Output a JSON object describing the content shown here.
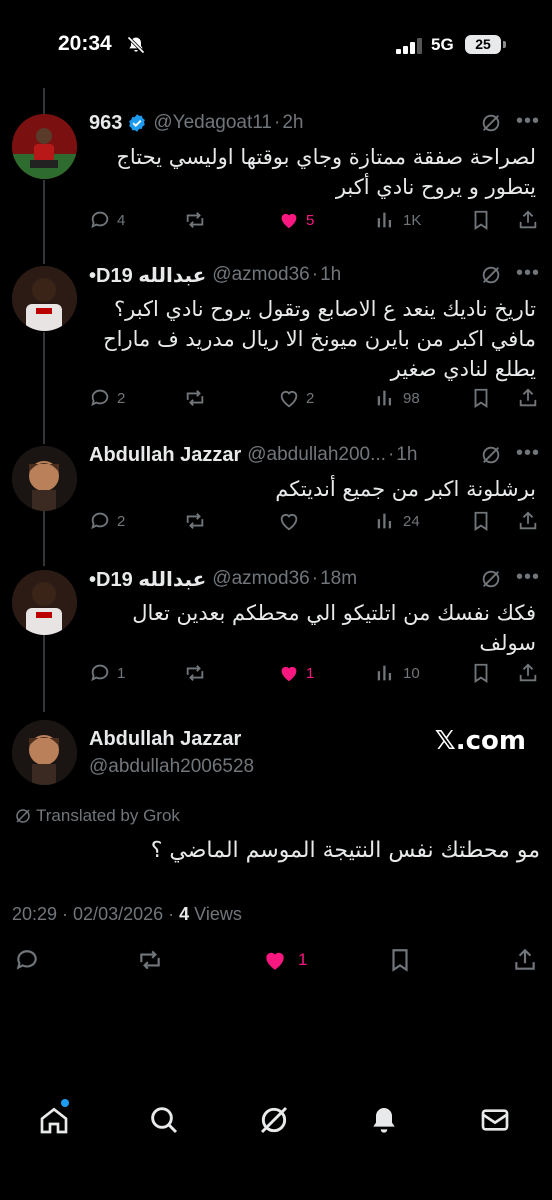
{
  "status_bar": {
    "time": "20:34",
    "network": "5G",
    "battery": "25"
  },
  "tweets": [
    {
      "name": "963",
      "verified": true,
      "handle": "@Yedagoat11",
      "time": "2h",
      "text": "لصراحة صفقة ممتازة وجاي بوقتها اوليسي يحتاج يتطور و يروح نادي أكبر",
      "replies": "4",
      "reposts": "",
      "likes": "5",
      "liked": true,
      "views": "1K"
    },
    {
      "name": "•D19 عبدالله",
      "verified": false,
      "handle": "@azmod36",
      "time": "1h",
      "text": "تاريخ ناديك ينعد ع الاصابع وتقول يروح نادي اكبر؟ مافي اكبر من بايرن ميونخ الا ريال مدريد ف ماراح يطلع لنادي صغير",
      "replies": "2",
      "reposts": "",
      "likes": "2",
      "liked": false,
      "views": "98"
    },
    {
      "name": "Abdullah Jazzar",
      "verified": false,
      "handle": "@abdullah200...",
      "time": "1h",
      "text": "برشلونة اكبر من جميع أنديتكم",
      "replies": "2",
      "reposts": "",
      "likes": "",
      "liked": false,
      "views": "24"
    },
    {
      "name": "•D19 عبدالله",
      "verified": false,
      "handle": "@azmod36",
      "time": "18m",
      "text": "فكك نفسك من اتلتيكو الي محطكم بعدين تعال سولف",
      "replies": "1",
      "reposts": "",
      "likes": "1",
      "liked": true,
      "views": "10"
    }
  ],
  "main_tweet": {
    "name": "Abdullah Jazzar",
    "handle": "@abdullah2006528",
    "watermark": "𝕏.com",
    "translated_label": "Translated by Grok",
    "text": "مو محطتك نفس النتيجة الموسم الماضي ؟",
    "timestamp": "20:29 · 02/03/2026 · ",
    "views_count": "4",
    "views_label": " Views",
    "likes": "1"
  },
  "nav": [
    "home-icon",
    "search-icon",
    "grok-icon",
    "notifications-icon",
    "messages-icon"
  ],
  "colors": {
    "like": "#f91880",
    "muted": "#71767b",
    "verified": "#1d9bf0",
    "text": "#e7e9ea"
  }
}
